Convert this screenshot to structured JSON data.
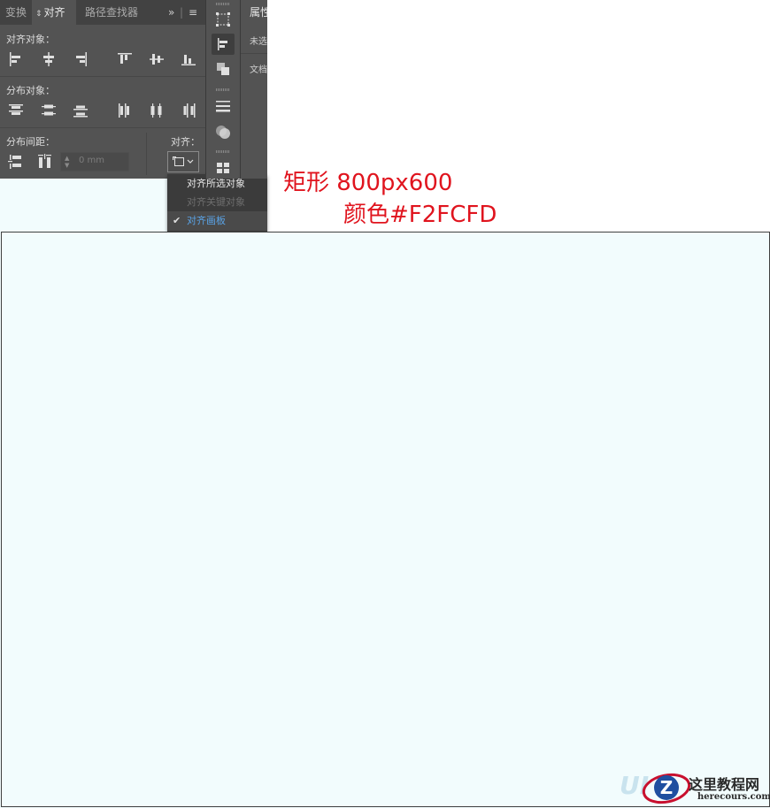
{
  "align_panel": {
    "tabs": [
      {
        "label": "变换"
      },
      {
        "label": "对齐"
      },
      {
        "label": "路径查找器"
      }
    ],
    "sections": {
      "align_objects": "对齐对象：",
      "distribute_objects": "分布对象：",
      "distribute_spacing": "分布间距：",
      "align_to": "对齐："
    },
    "spacing_value": "0 mm"
  },
  "align_to_menu": {
    "items": [
      {
        "label": "对齐所选对象",
        "state": "normal"
      },
      {
        "label": "对齐关键对象",
        "state": "disabled"
      },
      {
        "label": "对齐画板",
        "state": "checked"
      }
    ]
  },
  "properties_panel": {
    "title": "属性",
    "line1": "未选",
    "line2": "文档"
  },
  "annotation": {
    "line1": "矩形 800px600",
    "line2": "颜色#F2FCFD"
  },
  "rectangle": {
    "fill": "#F2FCFD"
  },
  "watermark": {
    "site_name": "这里教程网",
    "url": "herecours.com",
    "badge_letter": "Z",
    "ghost_text": "UI"
  },
  "colors": {
    "panel_bg": "#535353",
    "annotation_red": "#e0141e",
    "menu_check_blue": "#5aa3e6"
  }
}
